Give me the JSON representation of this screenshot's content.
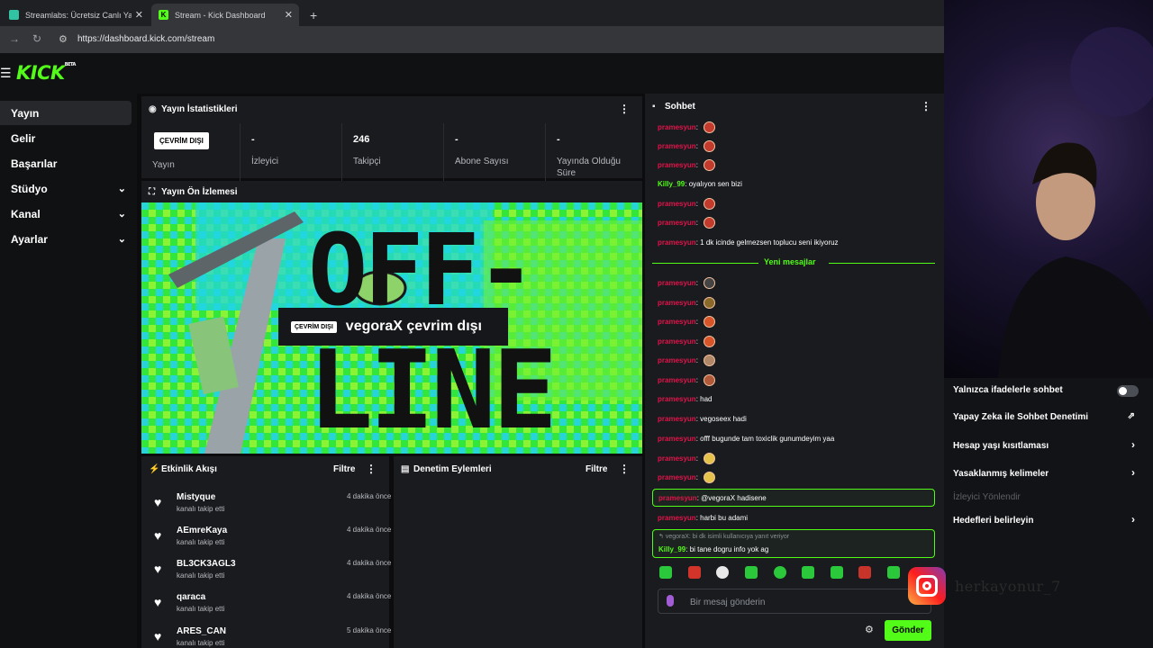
{
  "browser": {
    "tabs": [
      {
        "title": "Streamlabs: Ücretsiz Canlı Yayın",
        "favicon_color": "#31c3a2"
      },
      {
        "title": "Stream - Kick Dashboard",
        "favicon_color": "#53fc18"
      }
    ],
    "url": "https://dashboard.kick.com/stream",
    "new_tab": "+",
    "close": "✕"
  },
  "brand": {
    "logo": "KICK",
    "beta": "BETA",
    "accent": "#53fc18"
  },
  "sidebar": {
    "items": [
      {
        "label": "Yayın",
        "active": true,
        "chevron": false
      },
      {
        "label": "Gelir",
        "active": false,
        "chevron": false
      },
      {
        "label": "Başarılar",
        "active": false,
        "chevron": false
      },
      {
        "label": "Stüdyo",
        "active": false,
        "chevron": true
      },
      {
        "label": "Kanal",
        "active": false,
        "chevron": true
      },
      {
        "label": "Ayarlar",
        "active": false,
        "chevron": true
      }
    ]
  },
  "stats": {
    "title": "Yayın İstatistikleri",
    "status_badge": "ÇEVRİM DIŞI",
    "status_label": "Yayın",
    "viewers_value": "-",
    "viewers_label": "İzleyici",
    "followers_value": "246",
    "followers_label": "Takipçi",
    "subs_value": "-",
    "subs_label": "Abone Sayısı",
    "duration_value": "-",
    "duration_label": "Yayında Olduğu Süre"
  },
  "preview": {
    "title": "Yayın Ön İzlemesi",
    "badge": "ÇEVRİM DIŞI",
    "text": "vegoraX çevrim dışı",
    "bg_text_1": "OFF-",
    "bg_text_2": "LINE"
  },
  "activity": {
    "title": "Etkinlik Akışı",
    "filter": "Filtre",
    "items": [
      {
        "name": "Mistyque",
        "action": "kanalı takip etti",
        "time": "4 dakika önce"
      },
      {
        "name": "AEmreKaya",
        "action": "kanalı takip etti",
        "time": "4 dakika önce"
      },
      {
        "name": "BL3CK3AGL3",
        "action": "kanalı takip etti",
        "time": "4 dakika önce"
      },
      {
        "name": "qaraca",
        "action": "kanalı takip etti",
        "time": "4 dakika önce"
      },
      {
        "name": "ARES_CAN",
        "action": "kanalı takip etti",
        "time": "5 dakika önce"
      }
    ]
  },
  "moderation": {
    "title": "Denetim Eylemleri",
    "filter": "Filtre"
  },
  "chat": {
    "title": "Sohbet",
    "new_messages": "Yeni mesajlar",
    "messages": [
      {
        "user": "pramesyun",
        "text": "",
        "emote": true,
        "green": false
      },
      {
        "user": "pramesyun",
        "text": "",
        "emote": true,
        "green": false
      },
      {
        "user": "pramesyun",
        "text": "",
        "emote": true,
        "green": false
      },
      {
        "user": "Killy_99",
        "text": "oyalıyon sen bizi",
        "emote": false,
        "green": true
      },
      {
        "user": "pramesyun",
        "text": "",
        "emote": true,
        "green": false
      },
      {
        "user": "pramesyun",
        "text": "",
        "emote": true,
        "green": false
      },
      {
        "user": "pramesyun",
        "text": "1 dk icinde gelmezsen toplucu seni ikiyoruz",
        "emote": false,
        "green": false
      }
    ],
    "messages_after": [
      {
        "user": "pramesyun",
        "text": "",
        "emote": true,
        "green": false
      },
      {
        "user": "pramesyun",
        "text": "",
        "emote": true,
        "green": false
      },
      {
        "user": "pramesyun",
        "text": "",
        "emote": true,
        "green": false
      },
      {
        "user": "pramesyun",
        "text": "",
        "emote": true,
        "green": false
      },
      {
        "user": "pramesyun",
        "text": "",
        "emote": true,
        "green": false
      },
      {
        "user": "pramesyun",
        "text": "",
        "emote": true,
        "green": false
      },
      {
        "user": "pramesyun",
        "text": "had",
        "emote": false,
        "green": false
      },
      {
        "user": "pramesyun",
        "text": "vegoseex hadi",
        "emote": false,
        "green": false
      },
      {
        "user": "pramesyun",
        "text": "offf bugunde tam toxiclik gunumdeyim yaa",
        "emote": false,
        "green": false
      },
      {
        "user": "pramesyun",
        "text": "",
        "emote": true,
        "green": false
      },
      {
        "user": "pramesyun",
        "text": "",
        "emote": true,
        "green": false
      }
    ],
    "highlight_1": {
      "user": "pramesyun",
      "text": "@vegoraX hadisene"
    },
    "after_highlight": {
      "user": "pramesyun",
      "text": "harbi bu adami"
    },
    "reply_context": "vegoraX: bi dk isimli kullanıcıya yanıt veriyor",
    "highlight_2": {
      "user": "Killy_99",
      "text": "bi tane dogru info yok ag"
    },
    "input_placeholder": "Bir mesaj gönderin",
    "send": "Gönder"
  },
  "settings": {
    "emote_only": "Yalnızca ifadelerle sohbet",
    "ai_moderation": "Yapay Zeka ile Sohbet Denetimi",
    "age_restriction": "Hesap yaşı kısıtlaması",
    "banned_words": "Yasaklanmış kelimeler",
    "raid": "İzleyici Yönlendir",
    "goals": "Hedefleri belirleyin"
  },
  "overlay": {
    "instagram_handle": "herkayonur_7"
  }
}
